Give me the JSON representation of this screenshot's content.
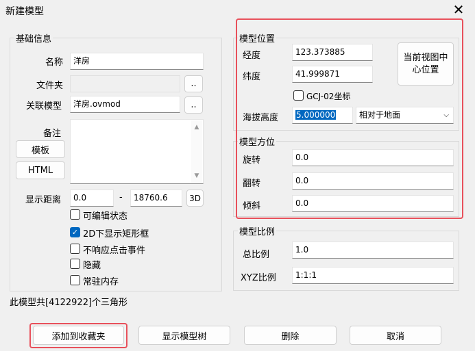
{
  "window": {
    "title": "新建模型",
    "close_icon": "close-icon"
  },
  "basic": {
    "legend": "基础信息",
    "name_label": "名称",
    "name_value": "洋房",
    "folder_label": "文件夹",
    "folder_value": "",
    "folder_btn": "..",
    "linked_label": "关联模型",
    "linked_value": "洋房.ovmod",
    "linked_btn": "..",
    "note_label": "备注",
    "template_btn": "模板",
    "html_btn": "HTML",
    "distance_label": "显示距离",
    "distance_min": "0.0",
    "distance_sep": "-",
    "distance_max": "18760.6",
    "btn_3d": "3D",
    "checks": {
      "editable": {
        "label": "可编辑状态",
        "checked": false
      },
      "show_box_2d": {
        "label": "2D下显示矩形框",
        "checked": true
      },
      "no_click": {
        "label": "不响应点击事件",
        "checked": false
      },
      "hidden": {
        "label": "隐藏",
        "checked": false
      },
      "resident": {
        "label": "常驻内存",
        "checked": false
      }
    }
  },
  "position": {
    "legend": "模型位置",
    "lon_label": "经度",
    "lon_value": "123.373885",
    "lat_label": "纬度",
    "lat_value": "41.999871",
    "gcj_label": "GCJ-02坐标",
    "gcj_checked": false,
    "alt_label": "海拔高度",
    "alt_value": "5.000000",
    "alt_mode": "相对于地面",
    "current_view_btn": "当前视图中心位置"
  },
  "orientation": {
    "legend": "模型方位",
    "rotate_label": "旋转",
    "rotate_value": "0.0",
    "flip_label": "翻转",
    "flip_value": "0.0",
    "tilt_label": "倾斜",
    "tilt_value": "0.0"
  },
  "scale": {
    "legend": "模型比例",
    "total_label": "总比例",
    "total_value": "1.0",
    "xyz_label": "XYZ比例",
    "xyz_value": "1:1:1"
  },
  "status_text": "此模型共[4122922]个三角形",
  "footer": {
    "add_fav": "添加到收藏夹",
    "show_tree": "显示模型树",
    "delete": "删除",
    "cancel": "取消"
  },
  "colors": {
    "highlight": "#e8505b",
    "accent": "#0067c0"
  }
}
